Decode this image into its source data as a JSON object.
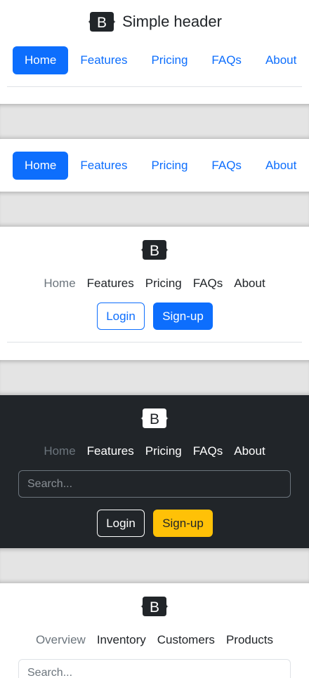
{
  "header1": {
    "title": "Simple header",
    "nav": [
      "Home",
      "Features",
      "Pricing",
      "FAQs",
      "About"
    ]
  },
  "header2": {
    "nav": [
      "Home",
      "Features",
      "Pricing",
      "FAQs",
      "About"
    ]
  },
  "header3": {
    "nav": [
      "Home",
      "Features",
      "Pricing",
      "FAQs",
      "About"
    ],
    "login_label": "Login",
    "signup_label": "Sign-up"
  },
  "header4": {
    "nav": [
      "Home",
      "Features",
      "Pricing",
      "FAQs",
      "About"
    ],
    "search_placeholder": "Search...",
    "login_label": "Login",
    "signup_label": "Sign-up"
  },
  "header5": {
    "nav": [
      "Overview",
      "Inventory",
      "Customers",
      "Products"
    ],
    "search_placeholder": "Search..."
  },
  "logo": {
    "letter": "B",
    "icon": "bootstrap-logo-icon"
  },
  "colors": {
    "primary": "#0d6efd",
    "dark": "#212529",
    "warning": "#ffc107",
    "muted": "#6c757d",
    "border": "#dee2e6",
    "divider": "#e4e4e4"
  }
}
